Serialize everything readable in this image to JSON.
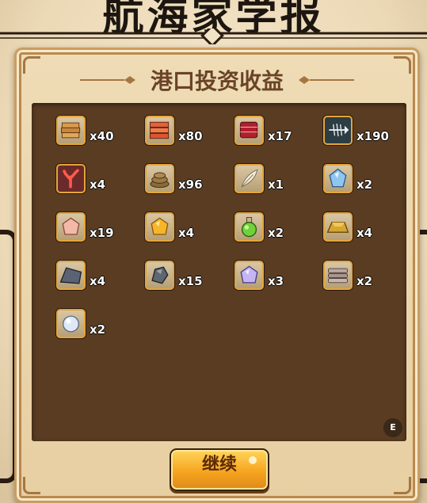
{
  "banner": {
    "title": "航海家学报"
  },
  "panel": {
    "title": "港口投资收益"
  },
  "items": [
    {
      "icon": "wood-planks-icon",
      "qty": "x40"
    },
    {
      "icon": "brick-stack-icon",
      "qty": "x80"
    },
    {
      "icon": "red-cloth-bolt-icon",
      "qty": "x17"
    },
    {
      "icon": "fishbone-icon",
      "qty": "x190"
    },
    {
      "icon": "coral-icon",
      "qty": "x4"
    },
    {
      "icon": "rope-coil-icon",
      "qty": "x96"
    },
    {
      "icon": "feather-icon",
      "qty": "x1"
    },
    {
      "icon": "blue-crystal-icon",
      "qty": "x2"
    },
    {
      "icon": "pink-gem-icon",
      "qty": "x19"
    },
    {
      "icon": "gold-gem-icon",
      "qty": "x4"
    },
    {
      "icon": "green-potion-icon",
      "qty": "x2"
    },
    {
      "icon": "gold-ingot-icon",
      "qty": "x4"
    },
    {
      "icon": "slate-slab-icon",
      "qty": "x4"
    },
    {
      "icon": "iron-ore-icon",
      "qty": "x15"
    },
    {
      "icon": "purple-gem-icon",
      "qty": "x3"
    },
    {
      "icon": "stone-bricks-icon",
      "qty": "x2"
    },
    {
      "icon": "pearl-icon",
      "qty": "x2"
    }
  ],
  "badge": {
    "label": "E"
  },
  "buttons": {
    "continue_label": "继续"
  },
  "colors": {
    "grid_bg": "#593c22",
    "slot_border": "#e4a53a",
    "button": "#f6a51f"
  }
}
